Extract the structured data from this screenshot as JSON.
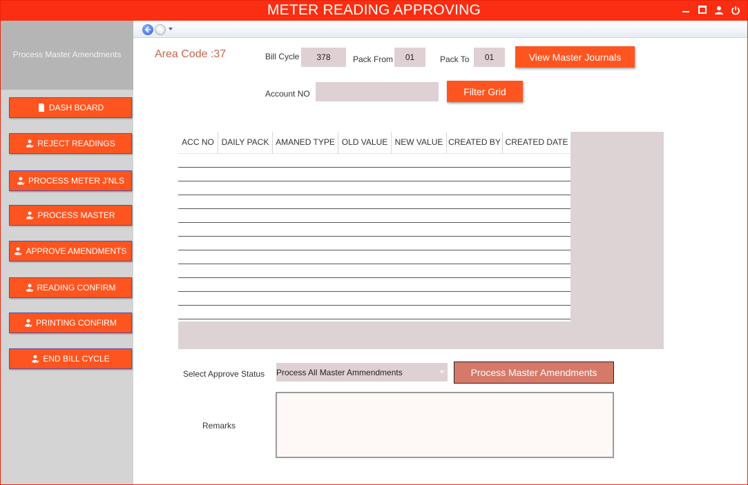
{
  "window": {
    "title": "METER READING APPROVING",
    "controls": [
      "minimize-icon",
      "maximize-icon",
      "user-icon",
      "power-icon"
    ]
  },
  "sidebar": {
    "title": "Process Master Amendments",
    "items": [
      {
        "label": "DASH BOARD",
        "icon": "document-icon"
      },
      {
        "label": "REJECT READINGS",
        "icon": "user-edit-icon"
      },
      {
        "label": "PROCESS METER J'NLS",
        "icon": "user-edit-icon"
      },
      {
        "label": "PROCESS MASTER",
        "icon": "user-edit-icon"
      },
      {
        "label": "APPROVE AMENDMENTS",
        "icon": "user-edit-icon"
      },
      {
        "label": "READING CONFIRM",
        "icon": "user-edit-icon"
      },
      {
        "label": "PRINTING CONFIRM",
        "icon": "user-edit-icon"
      },
      {
        "label": "END BILL CYCLE",
        "icon": "user-edit-icon"
      }
    ]
  },
  "filters": {
    "area_code": "Area Code :37",
    "bill_cycle_label": "Bill Cycle",
    "bill_cycle_value": "378",
    "pack_from_label": "Pack From",
    "pack_from_value": "01",
    "pack_to_label": "Pack To",
    "pack_to_value": "01",
    "view_button": "View Master Journals",
    "account_label": "Account NO",
    "account_value": "",
    "filter_button": "Filter Grid"
  },
  "grid": {
    "columns": [
      "ACC NO",
      "DAILY PACK",
      "AMANED TYPE",
      "OLD VALUE",
      "NEW VALUE",
      "CREATED BY",
      "CREATED DATE"
    ],
    "rows": []
  },
  "approve": {
    "status_label": "Select Approve Status",
    "status_value": "Process All Master Ammendments",
    "process_button": "Process Master Amendments",
    "remarks_label": "Remarks",
    "remarks_value": ""
  },
  "colors": {
    "accent": "#fe5520",
    "titlebar": "#fb2e11",
    "input_bg": "#dfd1d3"
  }
}
